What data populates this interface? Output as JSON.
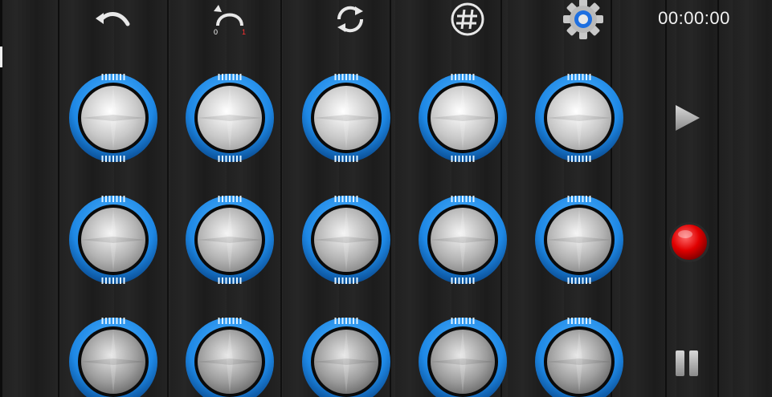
{
  "toolbar": {
    "undo_icon": "undo-arrow-icon",
    "loop_icon": "loop-counter-icon",
    "loop_start_label": "0",
    "loop_end_label": "1",
    "refresh_icon": "refresh-icon",
    "grid_icon": "hash-icon",
    "settings_icon": "gear-icon"
  },
  "timer": {
    "value": "00:00:00"
  },
  "pads": {
    "rows": 3,
    "columns": 5,
    "ring_color": "#1e88e5",
    "ring_highlight": "#4fb3ff"
  },
  "transport": {
    "play_icon": "play-icon",
    "record_icon": "record-icon",
    "pause_icon": "pause-icon",
    "record_color": "#e00000"
  }
}
